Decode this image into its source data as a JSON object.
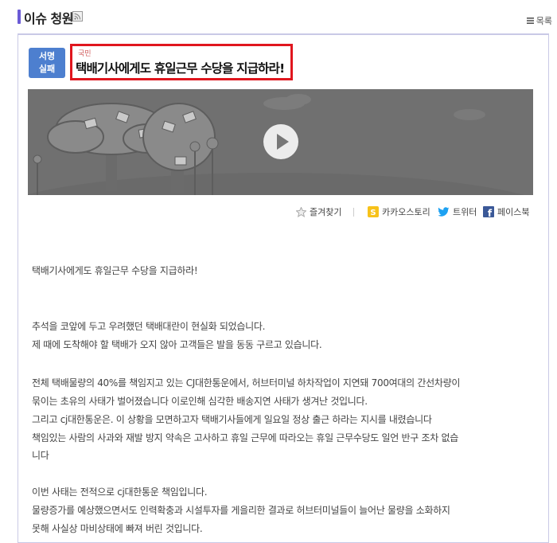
{
  "header": {
    "title": "이슈 청원",
    "list_label": "목록"
  },
  "badge": {
    "line1": "서명",
    "line2": "실패"
  },
  "petition": {
    "category": "국민",
    "title": "택배기사에게도 휴일근무 수당을 지급하라!"
  },
  "share": {
    "favorite": "즐겨찾기",
    "kakao": "카카오스토리",
    "twitter": "트위터",
    "facebook": "페이스북"
  },
  "body": {
    "lines": [
      "택배기사에게도 휴일근무 수당을 지급하라!",
      "추석을 코앞에 두고 우려했던 택배대란이 현실화 되었습니다.",
      "제 때에 도착해야 할 택배가 오지 않아 고객들은 발을 동동 구르고 있습니다.",
      "전체 택배물량의 40%를 책임지고 있는 CJ대한통운에서, 허브터미널 하차작업이 지연돼 700여대의 간선차량이",
      "묶이는 초유의 사태가 벌어졌습니다 이로인해 심각한 배송지연 사태가 생겨난 것입니다.",
      "그리고 cj대한통운은. 이 상황을 모면하고자 택배기사들에게 일요일 정상 출근 하라는 지시를 내렸습니다",
      "책임있는 사람의 사과와 재발 방지 약속은 고사하고 휴일 근무에 따라오는 휴일 근무수당도 일언 반구 조차 없습",
      "니다",
      "이번 사태는 전적으로 cj대한통운 책임입니다.",
      "물량증가를 예상했으면서도 인력확충과 시설투자를 게을리한 결과로 허브터미널들이 늘어난 물량을 소화하지",
      "못해 사실상 마비상태에 빠져 버린 것입니다."
    ]
  },
  "colors": {
    "accent": "#6b5bd6",
    "badge": "#4d7fcf",
    "highlight_border": "#e0161e",
    "kakao": "#f7c21a",
    "twitter": "#1da1f2",
    "facebook": "#3b5998"
  }
}
